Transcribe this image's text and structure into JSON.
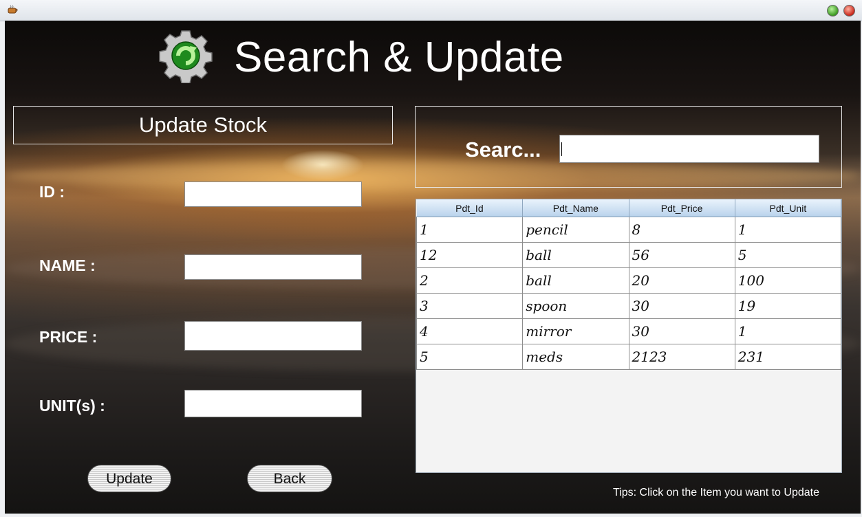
{
  "window": {
    "app_icon": "java-cup-icon",
    "controls": [
      "maximize-button",
      "close-button"
    ]
  },
  "header": {
    "title": "Search & Update",
    "icon": "gear-refresh-icon"
  },
  "update_form": {
    "section_title": "Update Stock",
    "fields": [
      {
        "label": "ID :",
        "value": ""
      },
      {
        "label": "NAME :",
        "value": ""
      },
      {
        "label": "PRICE :",
        "value": ""
      },
      {
        "label": "UNIT(s) :",
        "value": ""
      }
    ],
    "update_label": "Update",
    "back_label": "Back"
  },
  "search": {
    "label": "Searc...",
    "value": ""
  },
  "table": {
    "columns": [
      "Pdt_Id",
      "Pdt_Name",
      "Pdt_Price",
      "Pdt_Unit"
    ],
    "rows": [
      [
        "1",
        "pencil",
        "8",
        "1"
      ],
      [
        "12",
        "ball",
        "56",
        "5"
      ],
      [
        "2",
        "ball",
        "20",
        "100"
      ],
      [
        "3",
        "spoon",
        "30",
        "19"
      ],
      [
        "4",
        "mirror",
        "30",
        "1"
      ],
      [
        "5",
        "meds",
        "2123",
        "231"
      ]
    ]
  },
  "tip": "Tips: Click on the Item you want to Update",
  "colors": {
    "text": "#ffffff",
    "header_bg": "#b9d3ec",
    "close": "#c8261a",
    "maximize": "#3b9a22"
  }
}
